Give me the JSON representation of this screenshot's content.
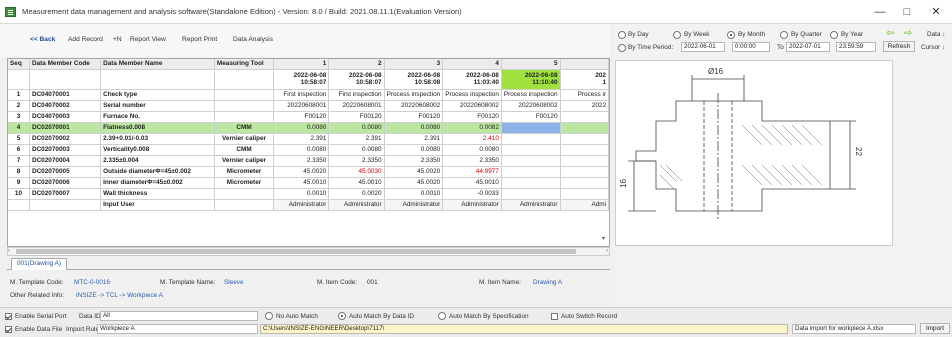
{
  "window": {
    "title": "Measurement data management and analysis software(Standalone Edition) - Version: 8.0 / Build: 2021.08.11.1(Evaluation Version)",
    "minimize": "—",
    "maximize": "□",
    "close": "✕"
  },
  "toolbar": {
    "back": "<< Back",
    "add_record": "Add Record",
    "add_n": "+N",
    "report_view": "Report View",
    "report_print": "Report Print",
    "data_analysis": "Data Analysis"
  },
  "grid": {
    "columns": [
      "Seq",
      "Data Member Code",
      "Data Member Name",
      "Measuring Tool"
    ],
    "record_cols": [
      {
        "num": "1",
        "date": "2022-06-08",
        "time": "10:58:07"
      },
      {
        "num": "2",
        "date": "2022-06-08",
        "time": "10:58:07"
      },
      {
        "num": "3",
        "date": "2022-06-08",
        "time": "10:58:08"
      },
      {
        "num": "4",
        "date": "2022-06-08",
        "time": "11:03:40"
      },
      {
        "num": "5",
        "date": "2022-06-08",
        "time": "11:10:40"
      },
      {
        "num": "",
        "date": "202",
        "time": "1"
      }
    ],
    "rows": [
      {
        "seq": "1",
        "code": "DC04070001",
        "name": "Check type",
        "tool": "",
        "values": [
          "First inspection",
          "First inspection",
          "Process inspection",
          "Process inspection",
          "Process inspection",
          "Process ir"
        ]
      },
      {
        "seq": "2",
        "code": "DC04070002",
        "name": "Serial number",
        "tool": "",
        "values": [
          "20220608001",
          "20220608001",
          "20220608002",
          "20220608002",
          "20220608002",
          "2022"
        ]
      },
      {
        "seq": "3",
        "code": "DC04070003",
        "name": "Furnace No.",
        "tool": "",
        "values": [
          "F00120",
          "F00120",
          "F00120",
          "F00120",
          "F00120",
          ""
        ]
      },
      {
        "seq": "4",
        "code": "DC02070001",
        "name": "Flatness0.008",
        "tool": "CMM",
        "values": [
          "0.0080",
          "0.0080",
          "0.0080",
          "0.0082",
          "",
          ""
        ]
      },
      {
        "seq": "5",
        "code": "DC02070002",
        "name": "2.39+0.01/-0.03",
        "tool": "Vernier caliper",
        "values": [
          "2.391",
          "2.391",
          "2.391",
          "2.410",
          "",
          ""
        ]
      },
      {
        "seq": "6",
        "code": "DC02070003",
        "name": "Verticality0.008",
        "tool": "CMM",
        "values": [
          "0.0080",
          "0.0080",
          "0.0080",
          "0.0080",
          "",
          ""
        ]
      },
      {
        "seq": "7",
        "code": "DC02070004",
        "name": "2.335±0.004",
        "tool": "Vernier caliper",
        "values": [
          "2.3350",
          "2.3350",
          "2.3350",
          "2.3350",
          "",
          ""
        ]
      },
      {
        "seq": "8",
        "code": "DC02070005",
        "name": "Outside diameterΦ=45±0.002",
        "tool": "Micrometer",
        "values": [
          "45.0020",
          "45.0030",
          "45.0020",
          "44.9977",
          "",
          ""
        ]
      },
      {
        "seq": "9",
        "code": "DC02070006",
        "name": "Inner diameterΦ=45±0.002",
        "tool": "Micrometer",
        "values": [
          "45.0010",
          "45.0010",
          "45.0020",
          "45.0010",
          "",
          ""
        ]
      },
      {
        "seq": "10",
        "code": "DC02070007",
        "name": "Wall thickness",
        "tool": "",
        "values": [
          "0.0010",
          "0.0020",
          "0.0010",
          "-0.0033",
          "",
          ""
        ]
      },
      {
        "seq": "",
        "code": "",
        "name": "Input User",
        "tool": "",
        "values": [
          "Administrator",
          "Administrator",
          "Administrator",
          "Administrator",
          "Administrator",
          "Admi"
        ]
      }
    ]
  },
  "tabs": [
    "001(Drawing A)"
  ],
  "info": {
    "template_code_label": "M. Template Code:",
    "template_code": "MTC-0-0016",
    "template_name_label": "M. Template Name:",
    "template_name": "Sleeve",
    "item_code_label": "M. Item Code:",
    "item_code": "001",
    "item_name_label": "M. Item Name:",
    "item_name": "Drawing A",
    "other_label": "Other Related Info:",
    "other": "INSIZE -> TCL -> Workpiece A"
  },
  "filter": {
    "by_day": "By Day",
    "by_week": "By Week",
    "by_month": "By Month",
    "by_quarter": "By Quarter",
    "by_year": "By Year",
    "by_time_period": "By Time Period:",
    "from_date": "2022-06-01",
    "from_time": "0:00:00",
    "to_label": "To",
    "to_date": "2022-07-01",
    "to_time": "23:59:59",
    "refresh": "Refresh",
    "cursor": "Cursor ↓",
    "data": "Data ↓"
  },
  "drawing": {
    "dim_top": "Ø16",
    "dim_right": "22",
    "dim_left": "16"
  },
  "bottom": {
    "enable_serial_port": "Enable Serial Port",
    "data_id_label": "Data ID:",
    "data_id_value": "All",
    "no_auto_match": "No Auto Match",
    "auto_match_by_data_id": "Auto Match By Data ID",
    "auto_match_by_spec": "Auto Match By Specification",
    "auto_switch_record": "Auto Switch Record",
    "enable_data_file": "Enable Data File",
    "import_rule_label": "Import Rule:",
    "import_rule_value": "Workpiece A",
    "file_path": "C:\\Users\\INSIZE-ENGINEER\\Desktop\\7117\\",
    "status": "Data import for workpiece A.xlsx",
    "import": "Import"
  },
  "colors": {
    "row_highlight": "#bce7a0",
    "column_highlight": "#9fe23f",
    "selected_cell": "#8fb0e6",
    "out_of_tolerance": "#d40000",
    "link_blue": "#1c4f9c"
  }
}
